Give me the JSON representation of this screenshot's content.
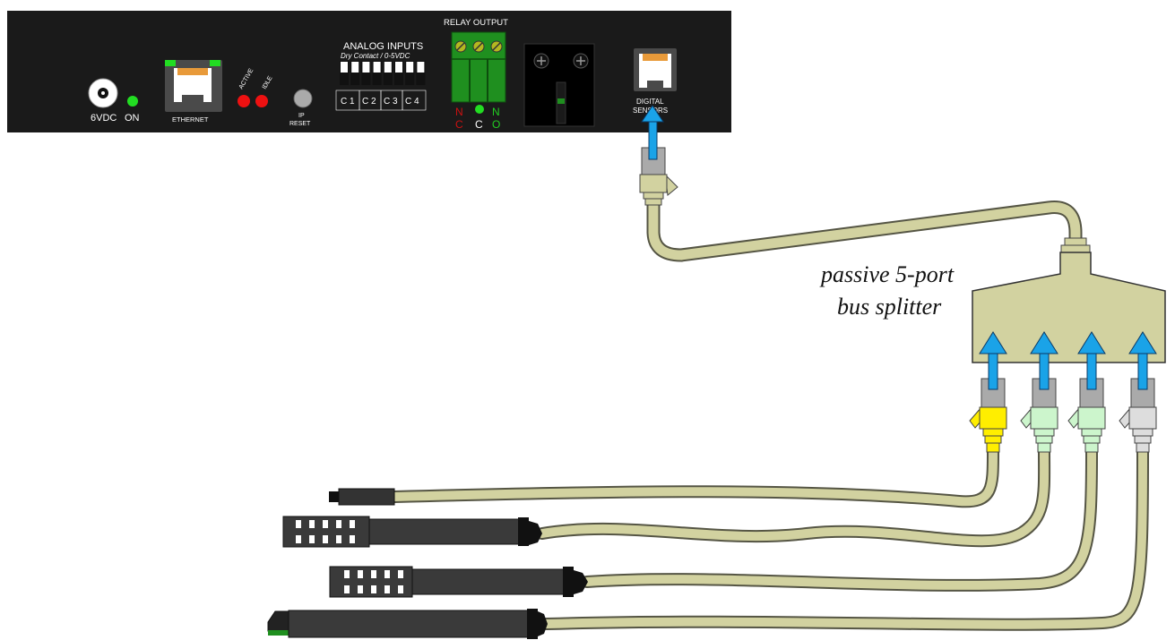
{
  "device": {
    "power_label": "6VDC",
    "on_label": "ON",
    "ethernet_label": "ETHERNET",
    "active_label": "ACTIVE",
    "idle_label": "IDLE",
    "ip_label": "IP",
    "reset_label": "RESET",
    "analog_title": "ANALOG INPUTS",
    "analog_subtitle": "Dry Contact / 0-5VDC",
    "analog_channels": [
      "C 1",
      "C 2",
      "C 3",
      "C 4"
    ],
    "relay_title": "RELAY OUTPUT",
    "relay_terminals": [
      {
        "top": "N",
        "bottom": "C",
        "color": "#cc1111"
      },
      {
        "top": "",
        "bottom": "C",
        "color": "#ffffff"
      },
      {
        "top": "N",
        "bottom": "O",
        "color": "#22cc22"
      }
    ],
    "digital_label_1": "DIGITAL",
    "digital_label_2": "SENSORS"
  },
  "splitter": {
    "label_line1": "passive 5-port",
    "label_line2": "bus splitter"
  },
  "colors": {
    "panel": "#1a1a1a",
    "cable": "#d2d2a0",
    "cable_outline": "#555544",
    "arrow": "#1aa3e8",
    "led_green": "#22dd22",
    "led_red": "#ee1111",
    "terminal_green": "#1f8f1f",
    "plug_yellow": "#ffee00",
    "plug_green": "#ccf5cc",
    "plug_gray": "#dddddd"
  },
  "plug_colors": [
    "plug_yellow",
    "plug_green",
    "plug_green",
    "plug_gray"
  ]
}
